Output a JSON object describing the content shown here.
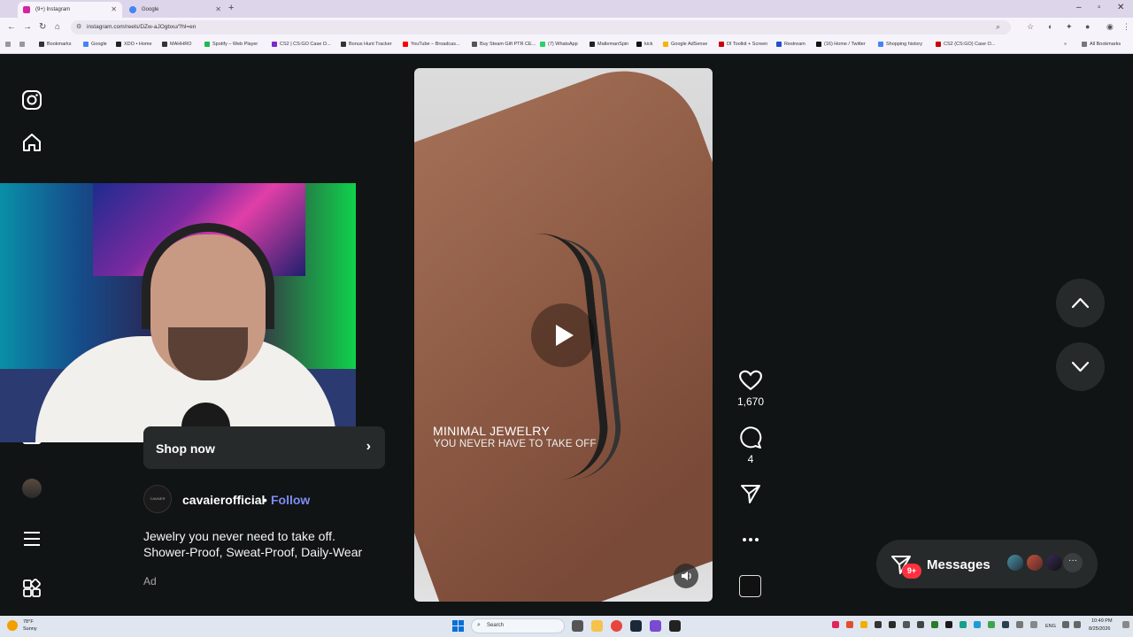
{
  "browser": {
    "tabs": [
      {
        "title": "(9+) Instagram",
        "active": true
      },
      {
        "title": "Google",
        "active": false
      }
    ],
    "url": "instagram.com/reels/DZw-aJOgbxu/?hl=en",
    "bookmarks": [
      "Bookmarks",
      "Google",
      "XDO • Home",
      "MAHHRO",
      "Spotify – Web Player",
      "CS2 | CS:GO Case O...",
      "Bonus Hunt Tracker",
      "YouTube – Broadcas...",
      "Buy Steam Gift PTR CE...",
      "(7) WhatsApp",
      "MatlemanSpin",
      "kick",
      "Google AdSense",
      "DI Toolkit + Screen",
      "Restream",
      "(16) Home / Twitter",
      "Shopping history",
      "CS2 (CS:GO) Case O...",
      "All Bookmarks"
    ]
  },
  "sidebar": {
    "icons": [
      "instagram-logo-icon",
      "home-icon",
      "shop-icon",
      "profile-avatar",
      "menu-icon",
      "more-apps-icon"
    ]
  },
  "post": {
    "shop_label": "Shop now",
    "account": "cavaierofficial",
    "separator": "•",
    "follow_label": "Follow",
    "avatar_text": "CAVAIER",
    "caption": "Jewelry you never need to take off.\nShower-Proof, Sweat-Proof, Daily-Wear",
    "ad_label": "Ad"
  },
  "reel": {
    "overlay_title": "MINIMAL JEWELRY",
    "overlay_subtitle": "YOU NEVER HAVE TO TAKE OFF"
  },
  "actions": {
    "likes": "1,670",
    "comments": "4"
  },
  "messages": {
    "label": "Messages",
    "badge": "9+"
  },
  "taskbar": {
    "weather_temp": "78°F",
    "weather_desc": "Sunny",
    "search_placeholder": "Search",
    "lang": "ENG",
    "time": "10:49 PM",
    "date": "8/25/2026"
  },
  "colors": {
    "page_bg": "#101414",
    "follow": "#7f8cf5",
    "badge": "#ff3040"
  }
}
